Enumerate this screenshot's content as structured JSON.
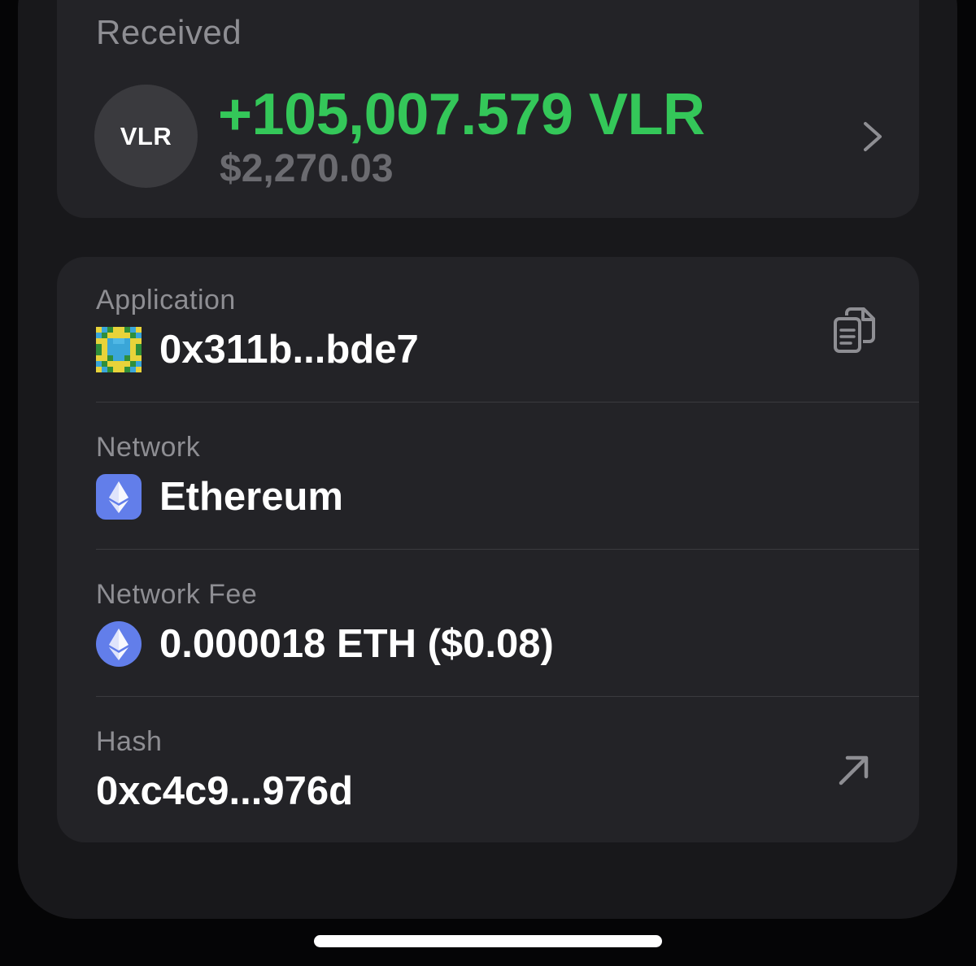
{
  "received": {
    "label": "Received",
    "token_symbol": "VLR",
    "amount": "+105,007.579 VLR",
    "fiat_value": "$2,270.03",
    "amount_color": "#34c759"
  },
  "details": {
    "application": {
      "label": "Application",
      "value": "0x311b...bde7",
      "icon": "pixel-avatar-icon",
      "action_icon": "copy-icon"
    },
    "network": {
      "label": "Network",
      "value": "Ethereum",
      "icon": "ethereum-square-icon"
    },
    "network_fee": {
      "label": "Network Fee",
      "value": "0.000018 ETH ($0.08)",
      "icon": "ethereum-circle-icon"
    },
    "hash": {
      "label": "Hash",
      "value": "0xc4c9...976d",
      "action_icon": "external-link-arrow-icon"
    }
  }
}
